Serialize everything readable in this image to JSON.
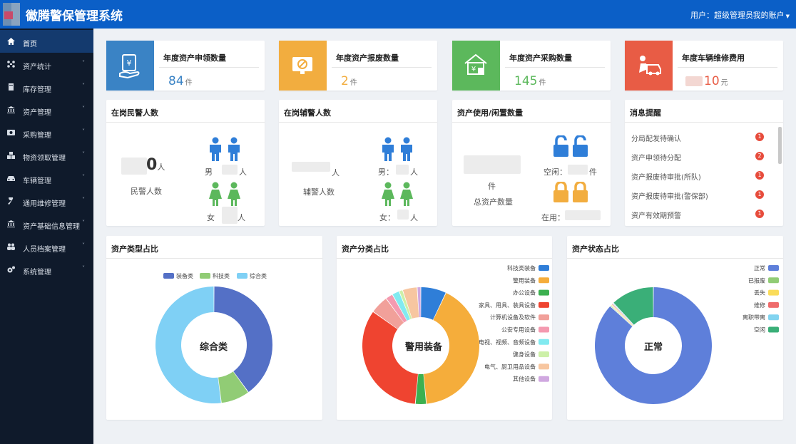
{
  "header": {
    "title": "徽腾警保管理系统",
    "user": "用户：超级管理员",
    "account": "我的账户",
    "colors": {
      "bar": "#0b5fc7"
    }
  },
  "sidebar": {
    "items": [
      {
        "label": "首页",
        "icon": "home-icon"
      },
      {
        "label": "资产统计",
        "icon": "stats-icon"
      },
      {
        "label": "库存管理",
        "icon": "book-icon"
      },
      {
        "label": "资产管理",
        "icon": "bank-icon"
      },
      {
        "label": "采购管理",
        "icon": "money-icon"
      },
      {
        "label": "物资领取管理",
        "icon": "cubes-icon"
      },
      {
        "label": "车辆管理",
        "icon": "car-icon"
      },
      {
        "label": "通用维修管理",
        "icon": "wrench-icon"
      },
      {
        "label": "资产基础信息管理",
        "icon": "bank-icon"
      },
      {
        "label": "人员档案管理",
        "icon": "users-icon"
      },
      {
        "label": "系统管理",
        "icon": "gears-icon"
      }
    ]
  },
  "stats": [
    {
      "title": "年度资产申领数量",
      "value": "84",
      "unit": "件",
      "color": "#3a83c5",
      "icon": "asset-claim-icon"
    },
    {
      "title": "年度资产报废数量",
      "value": "2",
      "unit": "件",
      "color": "#f2ad3f",
      "icon": "asset-scrap-icon"
    },
    {
      "title": "年度资产采购数量",
      "value": "145",
      "unit": "件",
      "color": "#5cb85c",
      "icon": "asset-purchase-icon"
    },
    {
      "title": "年度车辆维修费用",
      "value": "10",
      "unit": "元",
      "color": "#e85c45",
      "icon": "vehicle-repair-icon"
    }
  ],
  "police": {
    "title": "在岗民警人数",
    "total_digit": "0",
    "unit": "人",
    "label": "民警人数",
    "male_label": "男",
    "female_label": "女",
    "unit_small": "人"
  },
  "auxiliary": {
    "title": "在岗辅警人数",
    "total_unit": "人",
    "label": "辅警人数",
    "male_label": "男：",
    "female_label": "女：",
    "unit_small": "人"
  },
  "asset_usage": {
    "title": "资产使用/闲置数量",
    "unit": "件",
    "label": "总资产数量",
    "idle_label": "空闲：",
    "idle_unit": "件",
    "inuse_label": "在用："
  },
  "messages": {
    "title": "消息提醒",
    "items": [
      {
        "text": "分局配发待确认",
        "count": "1"
      },
      {
        "text": "资产申领待分配",
        "count": "2"
      },
      {
        "text": "资产报废待审批(所队)",
        "count": "1"
      },
      {
        "text": "资产报废待审批(警保部)",
        "count": "1"
      },
      {
        "text": "资产有效期预警",
        "count": "1"
      }
    ]
  },
  "chart_data": [
    {
      "type": "pie",
      "title": "资产类型占比",
      "center_label": "综合类",
      "legend_position": "top",
      "series": [
        {
          "name": "装备类",
          "value": 40,
          "color": "#5470c6"
        },
        {
          "name": "科技类",
          "value": 8,
          "color": "#91cc75"
        },
        {
          "name": "综合类",
          "value": 52,
          "color": "#7fd0f5"
        }
      ]
    },
    {
      "type": "pie",
      "title": "资产分类占比",
      "center_label": "警用装备",
      "legend_position": "right",
      "series": [
        {
          "name": "科技类装备",
          "value": 7,
          "color": "#2f7ed8"
        },
        {
          "name": "警用装备",
          "value": 41,
          "color": "#f5ad3b"
        },
        {
          "name": "办公设备",
          "value": 3,
          "color": "#3cb050"
        },
        {
          "name": "家具、用具、装具设备",
          "value": 33,
          "color": "#ef4430"
        },
        {
          "name": "计算机设备及软件",
          "value": 5,
          "color": "#f1a09a"
        },
        {
          "name": "公安专用设备",
          "value": 2,
          "color": "#f49ab0"
        },
        {
          "name": "电视、视频、音频设备",
          "value": 2,
          "color": "#82eaf0"
        },
        {
          "name": "健身设备",
          "value": 1,
          "color": "#cdf0a8"
        },
        {
          "name": "电气、厨卫用品设备",
          "value": 4,
          "color": "#f7c6a0"
        },
        {
          "name": "其他设备",
          "value": 1,
          "color": "#d0a8e0"
        }
      ]
    },
    {
      "type": "pie",
      "title": "资产状态占比",
      "center_label": "正常",
      "legend_position": "right",
      "series": [
        {
          "name": "正常",
          "value": 87,
          "color": "#5e7fda"
        },
        {
          "name": "已报废",
          "value": 0.3,
          "color": "#91cc75"
        },
        {
          "name": "丢失",
          "value": 0.3,
          "color": "#fadc5a"
        },
        {
          "name": "维修",
          "value": 0.3,
          "color": "#ef6b6b"
        },
        {
          "name": "离职带离",
          "value": 0.3,
          "color": "#82d4f0"
        },
        {
          "name": "空闲",
          "value": 12,
          "color": "#3aaf78"
        }
      ]
    }
  ]
}
